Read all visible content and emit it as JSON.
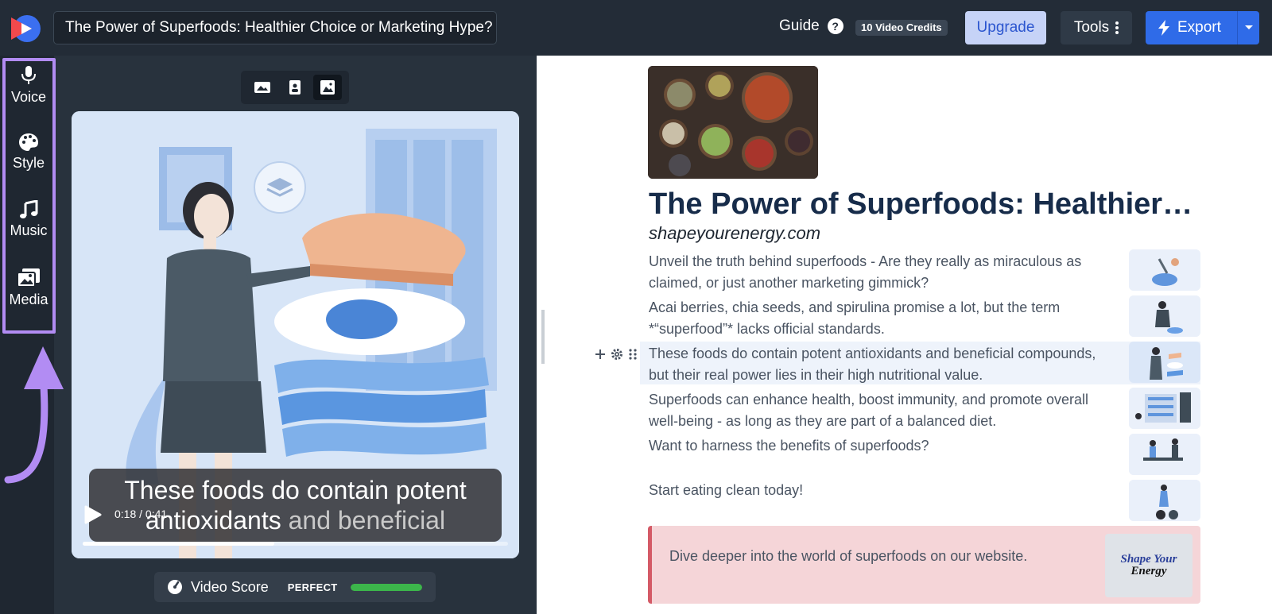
{
  "header": {
    "title_value": "The Power of Superfoods: Healthier Choice or Marketing Hype?",
    "guide_label": "Guide",
    "guide_help": "?",
    "credits": "10 Video Credits",
    "upgrade_label": "Upgrade",
    "tools_label": "Tools",
    "export_label": "Export"
  },
  "sidebar": {
    "items": [
      {
        "label": "Voice",
        "icon": "microphone-icon"
      },
      {
        "label": "Style",
        "icon": "palette-icon"
      },
      {
        "label": "Music",
        "icon": "music-note-icon"
      },
      {
        "label": "Media",
        "icon": "media-gallery-icon"
      }
    ],
    "highlight_color": "#b28cf3"
  },
  "view_toggle": {
    "options": [
      "landscape-icon",
      "portrait-icon",
      "square-icon"
    ],
    "active": "square-icon"
  },
  "player": {
    "caption_line1": "These foods do contain potent",
    "caption_line2_a": "antioxidants",
    "caption_line2_b": "and beneficial",
    "timecode": "0:18 / 0:41",
    "progress": 0.45
  },
  "score": {
    "label": "Video Score",
    "rating": "PERFECT",
    "level": 1.0,
    "color": "#3cb64b"
  },
  "document": {
    "title": "The Power of Superfoods: Healthier Choice or Marketing Hype?",
    "site": "shapeyourenergy.com",
    "scenes": [
      {
        "text": "Unveil the truth behind superfoods - Are they really as miraculous as claimed, or just another marketing gimmick?"
      },
      {
        "text": "Acai berries, chia seeds, and spirulina promise a lot, but the term *“superfood”* lacks official standards."
      },
      {
        "text": "These foods do contain potent antioxidants and beneficial compounds, but their real power lies in their high nutritional value."
      },
      {
        "text": "Superfoods can enhance health, boost immunity, and promote overall well-being - as long as they are part of a balanced diet."
      },
      {
        "text": "Want to harness the benefits of superfoods?"
      },
      {
        "text": "Start eating clean today!"
      }
    ],
    "cta_text": "Dive deeper into the world of superfoods on our website.",
    "cta_logo_line1": "Shape Your",
    "cta_logo_line2": "Energy",
    "accent_color": "#d45a66"
  }
}
